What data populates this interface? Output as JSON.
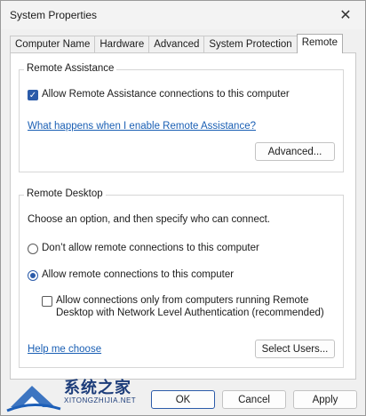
{
  "window": {
    "title": "System Properties"
  },
  "tabs": [
    {
      "label": "Computer Name",
      "active": false
    },
    {
      "label": "Hardware",
      "active": false
    },
    {
      "label": "Advanced",
      "active": false
    },
    {
      "label": "System Protection",
      "active": false
    },
    {
      "label": "Remote",
      "active": true
    }
  ],
  "remote_assistance": {
    "legend": "Remote Assistance",
    "allow_label": "Allow Remote Assistance connections to this computer",
    "allow_checked": true,
    "help_link": "What happens when I enable Remote Assistance?",
    "advanced_button": "Advanced..."
  },
  "remote_desktop": {
    "legend": "Remote Desktop",
    "instruction": "Choose an option, and then specify who can connect.",
    "option_dont_allow": "Don’t allow remote connections to this computer",
    "option_allow": "Allow remote connections to this computer",
    "selected_option": "allow",
    "nla_line1": "Allow connections only from computers running Remote",
    "nla_line2": "Desktop with Network Level Authentication (recommended)",
    "nla_checked": false,
    "help_link": "Help me choose",
    "select_users_button": "Select Users..."
  },
  "footer": {
    "ok": "OK",
    "cancel": "Cancel",
    "apply": "Apply"
  },
  "watermark": {
    "title": "系统之家",
    "subtitle": "XITONGZHIJIA.NET"
  }
}
